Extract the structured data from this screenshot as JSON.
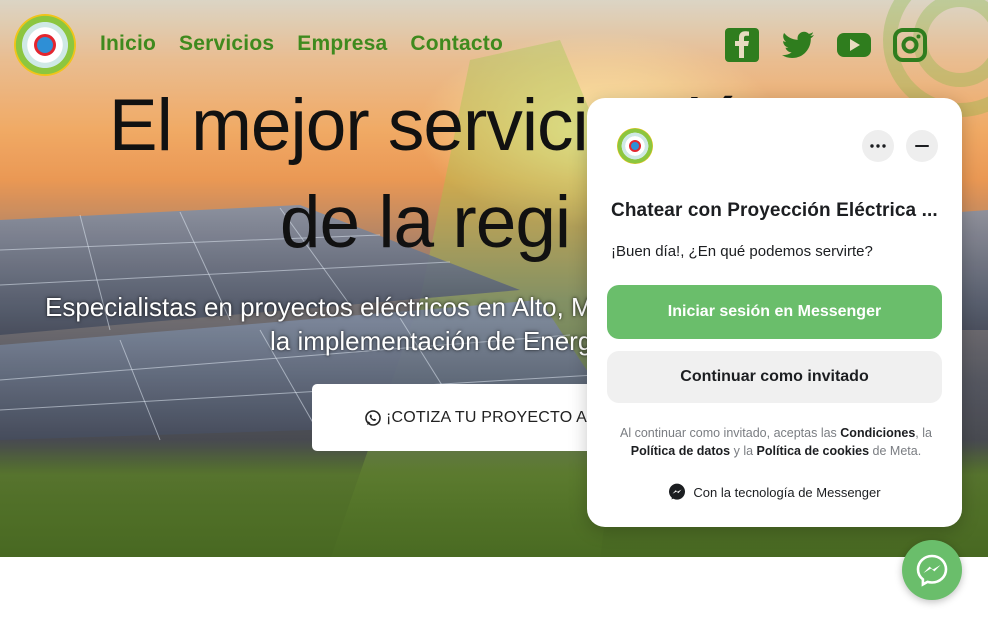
{
  "nav": {
    "items": [
      {
        "label": "Inicio"
      },
      {
        "label": "Servicios"
      },
      {
        "label": "Empresa"
      },
      {
        "label": "Contacto"
      }
    ],
    "social_icons": [
      "facebook-icon",
      "twitter-icon",
      "youtube-icon",
      "instagram-icon"
    ]
  },
  "hero": {
    "title_line1": "El mejor servicio elé",
    "title_line2": "de la regi",
    "subtitle_line1": "Especialistas en proyectos eléctricos en Alto, M",
    "subtitle_line2": "la implementación de Energ",
    "cta_label": "¡COTIZA TU PROYECTO AHO"
  },
  "chat": {
    "title": "Chatear con Proyección Eléctrica ...",
    "greeting": "¡Buen día!, ¿En qué podemos servirte?",
    "login_button": "Iniciar sesión en Messenger",
    "guest_button": "Continuar como invitado",
    "legal_prefix": "Al continuar como invitado, aceptas las ",
    "legal_link1": "Condiciones",
    "legal_mid1": ", la ",
    "legal_link2": "Política de datos",
    "legal_mid2": " y la ",
    "legal_link3": "Política de cookies",
    "legal_suffix": " de Meta.",
    "powered_by": "Con la tecnología de Messenger"
  },
  "colors": {
    "nav_green": "#3f8a1e",
    "messenger_green": "#6abe6b",
    "social_green": "#2f7d1e"
  }
}
